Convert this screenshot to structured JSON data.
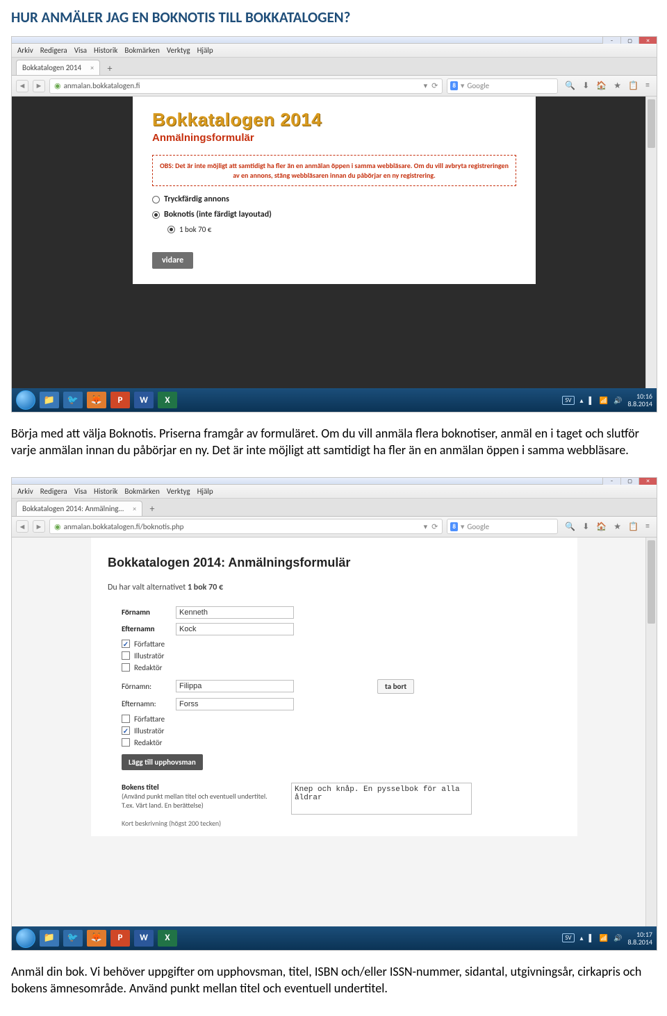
{
  "doc_heading": "HUR ANMÄLER JAG EN BOKNOTIS TILL BOKKATALOGEN?",
  "para1": "Börja med att välja Boknotis. Priserna framgår av formuläret. Om du vill anmäla flera boknotiser, anmäl en i taget och slutför varje anmälan innan du påbörjar en ny. Det är inte möjligt att samtidigt ha fler än en anmälan öppen i samma webbläsare.",
  "para2": "Anmäl din bok. Vi behöver uppgifter om upphovsman, titel, ISBN och/eller ISSN-nummer, sidantal, utgivningsår, cirkapris och bokens ämnesområde. Använd punkt mellan titel och eventuell undertitel.",
  "browser_menu": [
    "Arkiv",
    "Redigera",
    "Visa",
    "Historik",
    "Bokmärken",
    "Verktyg",
    "Hjälp"
  ],
  "search_placeholder": "Google",
  "addr_right_icons": [
    "🔍",
    "⬇",
    "🏠",
    "★",
    "📋",
    "≡"
  ],
  "shot1": {
    "tab_title": "Bokkatalogen 2014",
    "url": "anmalan.bokkatalogen.fi",
    "title": "Bokkatalogen 2014",
    "subtitle": "Anmälningsformulär",
    "obs": "OBS: Det är inte möjligt att samtidigt ha fler än en anmälan öppen i samma webbläsare. Om du vill avbryta registreringen av en annons, stäng webbläsaren innan du påbörjar en ny registrering.",
    "opt1": "Tryckfärdig annons",
    "opt2": "Boknotis (inte färdigt layoutad)",
    "opt2_sub": "1 bok 70 €",
    "btn": "vidare",
    "clock_time": "10:16",
    "clock_date": "8.8.2014",
    "lang": "SV"
  },
  "shot2": {
    "tab_title": "Bokkatalogen 2014: Anmälning…",
    "url": "anmalan.bokkatalogen.fi/boknotis.php",
    "heading": "Bokkatalogen 2014: Anmälningsformulär",
    "intro_prefix": "Du har valt alternativet ",
    "intro_bold": "1 bok 70 €",
    "labels": {
      "fornamn": "Förnamn",
      "efternamn": "Efternamn",
      "fornamn_c": "Förnamn:",
      "efternamn_c": "Efternamn:",
      "forfattare": "Författare",
      "illustrator": "Illustratör",
      "redaktor": "Redaktör"
    },
    "person1": {
      "fornamn": "Kenneth",
      "efternamn": "Kock",
      "forfattare": true,
      "illustrator": false,
      "redaktor": false
    },
    "person2": {
      "fornamn": "Filippa",
      "efternamn": "Forss",
      "forfattare": false,
      "illustrator": true,
      "redaktor": false
    },
    "btn_remove": "ta bort",
    "btn_add": "Lägg till upphovsman",
    "title_label": "Bokens titel",
    "title_help": "(Använd punkt mellan titel och eventuell undertitel. T.ex. Vårt land. En berättelse)",
    "title_value": "Knep och knåp. En pysselbok för alla åldrar",
    "cut_line": "Kort beskrivning (högst 200 tecken)",
    "clock_time": "10:17",
    "clock_date": "8.8.2014",
    "lang": "SV"
  },
  "taskbar_icons": [
    "📁",
    "🦊",
    "🐦",
    "🦊",
    "P",
    "W",
    "X"
  ]
}
